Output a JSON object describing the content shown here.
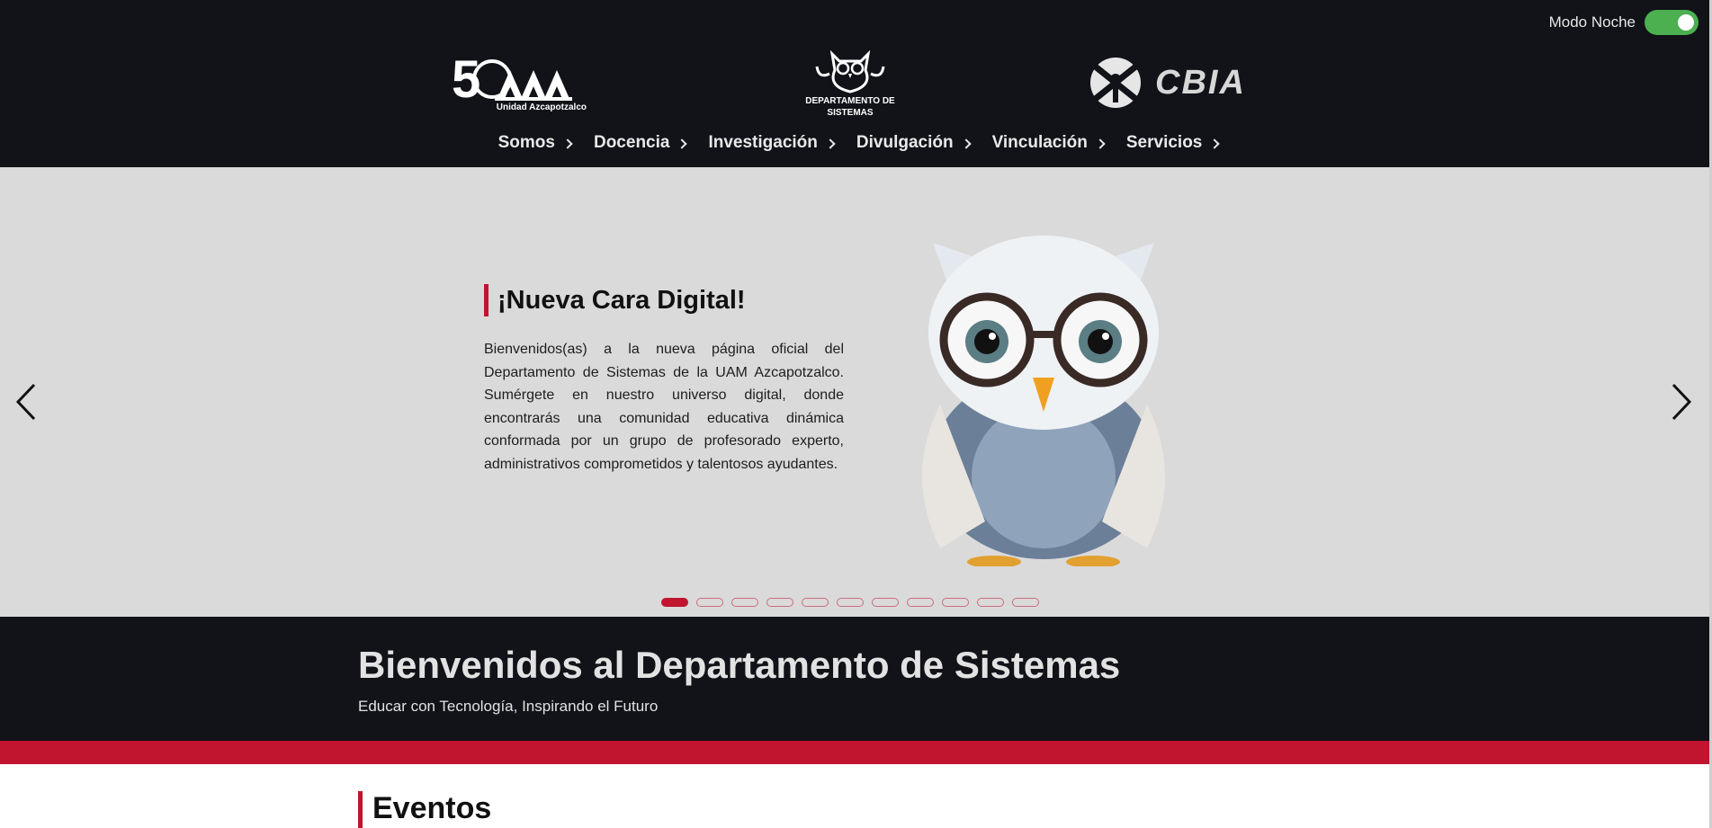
{
  "header": {
    "night_mode_label": "Modo Noche",
    "night_mode_on": true,
    "logos": {
      "uam_subtitle": "Unidad Azcapotzalco",
      "ds_caption_line1": "DEPARTAMENTO DE",
      "ds_caption_line2": "SISTEMAS",
      "cbia_word": "CBIA"
    },
    "nav": [
      {
        "label": "Somos"
      },
      {
        "label": "Docencia"
      },
      {
        "label": "Investigación"
      },
      {
        "label": "Divulgación"
      },
      {
        "label": "Vinculación"
      },
      {
        "label": "Servicios"
      }
    ]
  },
  "carousel": {
    "title": "¡Nueva Cara Digital!",
    "text": "Bienvenidos(as) a la nueva página oficial del Departamento de Sistemas de la UAM Azcapotzalco. Sumérgete en nuestro universo digital, donde encontrarás una comunidad educativa dinámica conformada por un grupo de profesorado experto, administrativos comprometidos y talentosos ayudantes.",
    "slide_count": 11,
    "active_slide": 1,
    "prev_icon": "chevron-left-icon",
    "next_icon": "chevron-right-icon"
  },
  "welcome": {
    "title": "Bienvenidos al Departamento de Sistemas",
    "subtitle": "Educar con Tecnología, Inspirando el Futuro"
  },
  "events": {
    "title": "Eventos"
  },
  "colors": {
    "dark_bg": "#111318",
    "carousel_bg": "#dadada",
    "accent_red": "#c0142f",
    "toggle_green": "#4caf50"
  }
}
